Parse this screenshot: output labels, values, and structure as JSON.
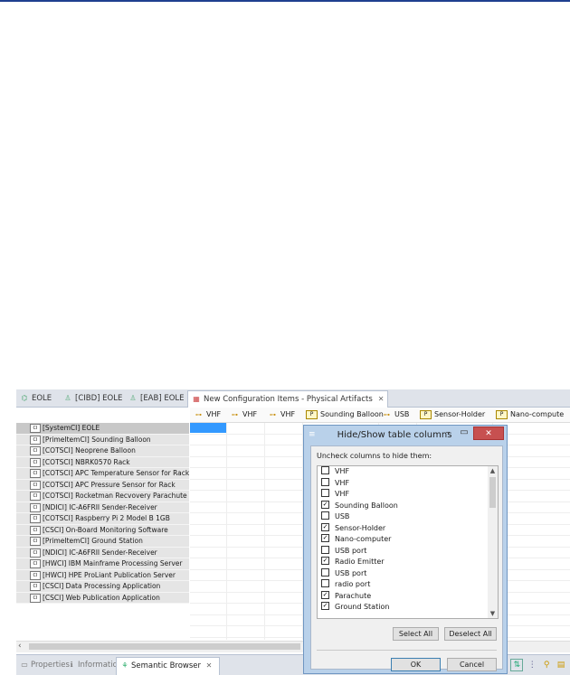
{
  "editor_tabs": [
    {
      "label": "EOLE",
      "icon": "tree-icon"
    },
    {
      "label": "[CIBD] EOLE",
      "icon": "diagram-icon"
    },
    {
      "label": "[EAB] EOLE",
      "icon": "diagram-icon"
    }
  ],
  "active_tab": {
    "label": "New Configuration Items - Physical Artifacts",
    "icon": "table-icon"
  },
  "column_headers": [
    "VHF",
    "VHF",
    "VHF",
    "Sounding Balloon",
    "USB",
    "Sensor-Holder",
    "Nano-compute"
  ],
  "tree_rows": [
    "[SystemCI] EOLE",
    "[PrimeItemCI] Sounding Balloon",
    "[COTSCI] Neoprene Balloon",
    "[COTSCI] NBRK0570 Rack",
    "[COTSCI] APC Temperature Sensor for Rack",
    "[COTSCI] APC Pressure Sensor for Rack",
    "[COTSCI] Rocketman Recvovery Parachute",
    "[NDICI] IC-A6FRII Sender-Receiver",
    "[COTSCI] Raspberry Pi 2 Model B 1GB",
    "[CSCI] On-Board Monitoring Software",
    "[PrimeItemCI] Ground Station",
    "[NDICI] IC-A6FRII Sender-Receiver",
    "[HWCI] IBM Mainframe Processing Server",
    "[HWCI] HPE ProLiant Publication Server",
    "[CSCI] Data Processing Application",
    "[CSCI] Web Publication Application"
  ],
  "bottom_tabs": [
    {
      "label": "Properties",
      "icon": "properties-icon"
    },
    {
      "label": "Information",
      "icon": "info-icon"
    }
  ],
  "bottom_active_tab": {
    "label": "Semantic Browser",
    "icon": "semantic-browser-icon"
  },
  "dialog": {
    "title": "Hide/Show table columns",
    "instruction": "Uncheck columns to hide them:",
    "items": [
      {
        "label": "VHF",
        "checked": false
      },
      {
        "label": "VHF",
        "checked": false
      },
      {
        "label": "VHF",
        "checked": false
      },
      {
        "label": "Sounding Balloon",
        "checked": true
      },
      {
        "label": "USB",
        "checked": false
      },
      {
        "label": "Sensor-Holder",
        "checked": true
      },
      {
        "label": "Nano-computer",
        "checked": true
      },
      {
        "label": "USB port",
        "checked": false
      },
      {
        "label": "Radio Emitter",
        "checked": true
      },
      {
        "label": "USB port",
        "checked": false
      },
      {
        "label": "radio port",
        "checked": false
      },
      {
        "label": "Parachute",
        "checked": true
      },
      {
        "label": "Ground Station",
        "checked": true
      }
    ],
    "select_all": "Select All",
    "deselect_all": "Deselect All",
    "ok": "OK",
    "cancel": "Cancel"
  },
  "colors": {
    "accent": "#3399ff",
    "dialog_frame": "#b9d1ea",
    "close": "#c75050"
  }
}
